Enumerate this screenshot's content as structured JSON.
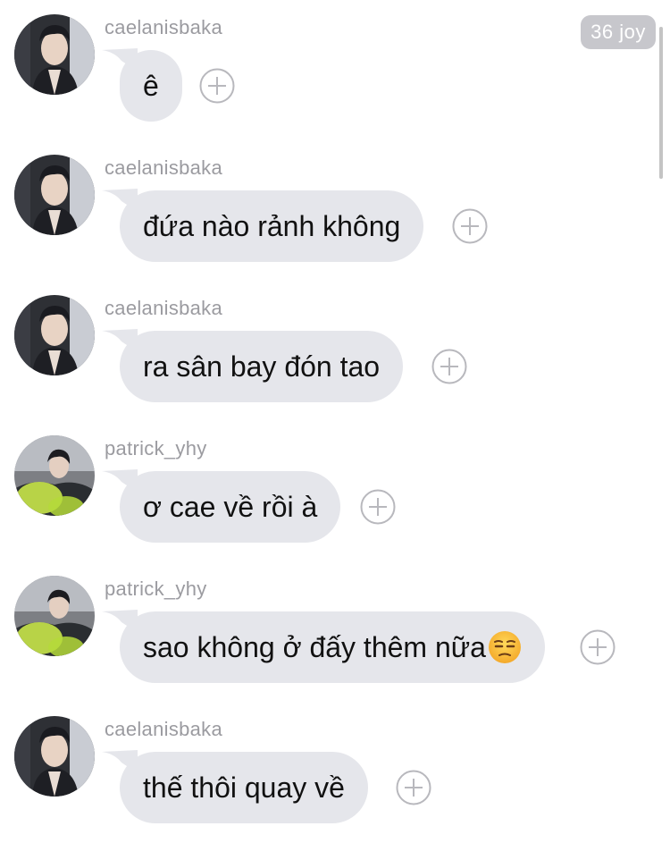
{
  "counter_badge": "36 joy",
  "messages": [
    {
      "sender": "caelanisbaka",
      "text": "ê",
      "avatar": "avatar-caelanisbaka"
    },
    {
      "sender": "caelanisbaka",
      "text": "đứa nào rảnh không",
      "avatar": "avatar-caelanisbaka"
    },
    {
      "sender": "caelanisbaka",
      "text": "ra sân bay đón tao",
      "avatar": "avatar-caelanisbaka"
    },
    {
      "sender": "patrick_yhy",
      "text": "ơ cae về rồi à",
      "avatar": "avatar-patrick_yhy"
    },
    {
      "sender": "patrick_yhy",
      "text": "sao không ở đấy thêm nữa",
      "avatar": "avatar-patrick_yhy",
      "emoji": "unamused-face-emoji"
    },
    {
      "sender": "caelanisbaka",
      "text": "thế thôi quay về",
      "avatar": "avatar-caelanisbaka"
    }
  ],
  "icons": {
    "reaction": "add-reaction-icon",
    "emoji": "unamused-face-emoji"
  },
  "colors": {
    "bubble": "#e5e6eb",
    "sender_text": "#9b9ba0",
    "badge": "#c7c7cc",
    "reaction_icon": "#b8b8bd"
  }
}
